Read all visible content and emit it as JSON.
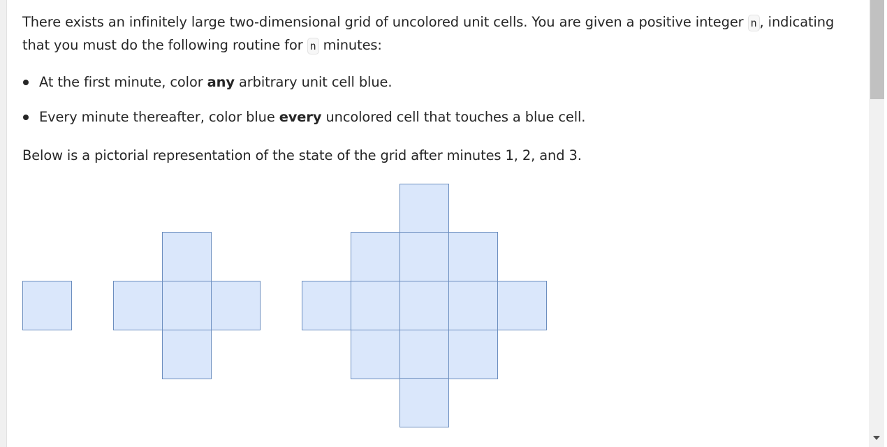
{
  "paragraph1": {
    "part1": "There exists an infinitely large two-dimensional grid of uncolored unit cells. You are given a positive integer ",
    "code1": "n",
    "part2": ", indicating that you must do the following routine for ",
    "code2": "n",
    "part3": " minutes:"
  },
  "bullets": [
    {
      "before": "At the first minute, color ",
      "bold": "any",
      "after": " arbitrary unit cell blue."
    },
    {
      "before": "Every minute thereafter, color blue ",
      "bold": "every",
      "after": " uncolored cell that touches a blue cell."
    }
  ],
  "paragraph2": "Below is a pictorial representation of the state of the grid after minutes 1, 2, and 3.",
  "figure": {
    "cell_fill": "#dae7fb",
    "cell_stroke": "#6c8ebf",
    "minutes": [
      1,
      2,
      3
    ]
  }
}
